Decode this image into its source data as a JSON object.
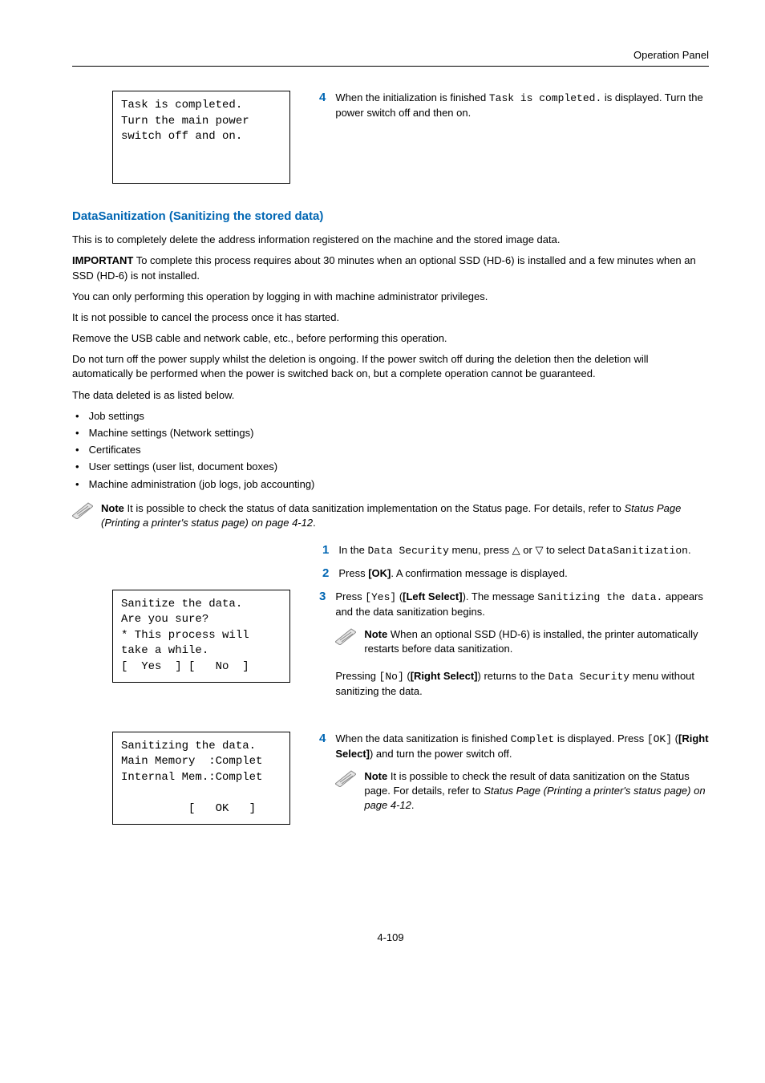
{
  "header": {
    "title": "Operation Panel"
  },
  "lcd1": {
    "l1": "Task is completed.",
    "l2": "Turn the main power",
    "l3": "switch off and on.",
    "l4": " ",
    "l5": " "
  },
  "topstep": {
    "num": "4",
    "t1": "When the initialization is finished ",
    "code": "Task is completed.",
    "t2": " is displayed. Turn the power switch off and then on."
  },
  "section": {
    "title": "DataSanitization (Sanitizing the stored data)",
    "p1": "This is to completely delete the address information registered on the machine and the stored image data.",
    "imp": "IMPORTANT",
    "p2": "  To complete this process requires about 30 minutes when an optional SSD (HD-6) is installed and a few minutes when an SSD (HD-6) is not installed.",
    "p3": "You can only performing this operation by logging in with machine administrator privileges.",
    "p4": "It is not possible to cancel the process once it has started.",
    "p5": "Remove the USB cable and network cable, etc., before performing this operation.",
    "p6": "Do not turn off the power supply whilst the deletion is ongoing. If the power switch off during the deletion then the deletion will automatically be performed when the power is switched back on, but a complete operation cannot be guaranteed.",
    "p7": "The data deleted is as listed below.",
    "bul": [
      "Job settings",
      "Machine settings (Network settings)",
      "Certificates",
      "User settings (user list, document boxes)",
      "Machine administration (job logs, job accounting)"
    ]
  },
  "note1": {
    "label": "Note",
    "t1": "  It is possible to check the status of data sanitization implementation on the Status page. For details, refer to ",
    "link": "Status Page (Printing a printer's status page) on page 4-12",
    "dot": "."
  },
  "steps_a": {
    "s1": {
      "n": "1",
      "t1": "In the ",
      "c1": "Data Security",
      "t2": " menu, press ",
      "t3": " or ",
      "t4": " to select ",
      "c2": "DataSanitization",
      "t5": "."
    },
    "s2": {
      "n": "2",
      "t1": "Press ",
      "b1": "[OK]",
      "t2": ". A confirmation message is displayed."
    }
  },
  "lcd2": {
    "l1": "Sanitize the data.",
    "l2": "Are you sure?",
    "l3": "* This process will",
    "l4": "take a while.",
    "l5": "[  Yes  ] [   No  ]"
  },
  "step3": {
    "n": "3",
    "t1": "Press ",
    "c1": "[Yes]",
    "t2": " (",
    "b1": "[Left Select]",
    "t3": "). The message ",
    "c2": "Sanitizing the data.",
    "t4": " appears and the data sanitization begins."
  },
  "note2": {
    "label": "Note",
    "t": "  When an optional SSD (HD-6) is installed, the printer automatically restarts before data sanitization."
  },
  "step3b": {
    "t1": "Pressing ",
    "c1": "[No]",
    "t2": " (",
    "b1": "[Right Select]",
    "t3": ") returns to the ",
    "c2": "Data Security",
    "t4": " menu without sanitizing the data."
  },
  "lcd3": {
    "l1": "Sanitizing the data.",
    "l2": "Main Memory  :Complet",
    "l3": "Internal Mem.:Complet",
    "l4": " ",
    "l5": "          [   OK   ]"
  },
  "step4": {
    "n": "4",
    "t1": "When the data sanitization is finished ",
    "c1": "Complet",
    "t2": " is displayed. Press ",
    "c2": "[OK]",
    "t3": " (",
    "b1": "[Right Select]",
    "t4": ") and turn the power switch off."
  },
  "note3": {
    "label": "Note",
    "t1": "  It is possible to check the result of data sanitization on the Status page. For details, refer to ",
    "link": "Status Page (Printing a printer's status page) on page 4-12",
    "dot": "."
  },
  "footer": {
    "page": "4-109"
  }
}
